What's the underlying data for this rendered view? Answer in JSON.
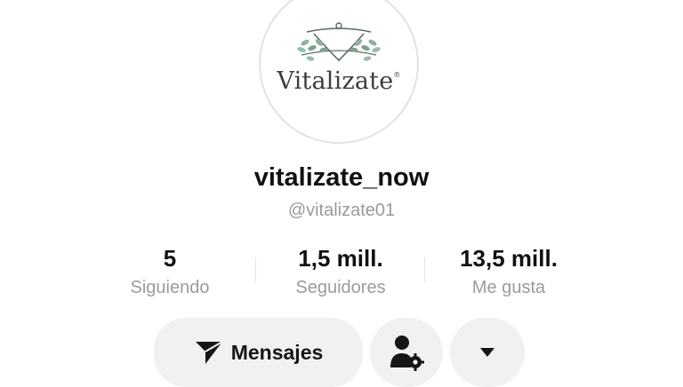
{
  "profile": {
    "logo_text": "Vitalizate",
    "display_name": "vitalizate_now",
    "handle": "@vitalizate01"
  },
  "stats": [
    {
      "value": "5",
      "label": "Siguiendo"
    },
    {
      "value": "1,5 mill.",
      "label": "Seguidores"
    },
    {
      "value": "13,5 mill.",
      "label": "Me gusta"
    }
  ],
  "actions": {
    "message_label": "Mensajes",
    "message_icon": "send-icon",
    "user_settings_icon": "user-settings-icon",
    "more_icon": "dropdown-arrow-icon"
  },
  "colors": {
    "logo_leaf": "#7fa08d",
    "button_bg": "#f1f1f1",
    "muted_text": "#9b9b9b"
  }
}
